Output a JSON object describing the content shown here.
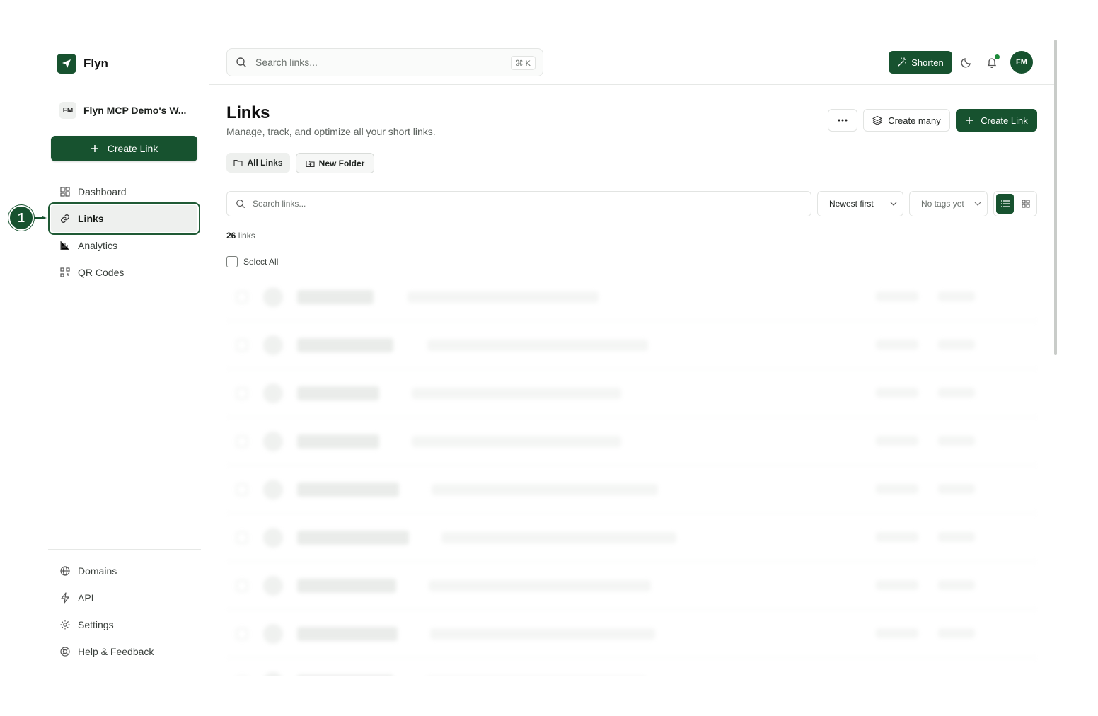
{
  "brand": {
    "name": "Flyn"
  },
  "workspace": {
    "initials": "FM",
    "name": "Flyn MCP Demo's W..."
  },
  "sidebar": {
    "create_label": "Create Link",
    "nav_top": [
      {
        "label": "Dashboard",
        "icon": "dashboard-icon"
      },
      {
        "label": "Links",
        "icon": "link-icon",
        "active": true
      },
      {
        "label": "Analytics",
        "icon": "chart-icon"
      },
      {
        "label": "QR Codes",
        "icon": "qr-icon"
      }
    ],
    "nav_bottom": [
      {
        "label": "Domains",
        "icon": "globe-icon"
      },
      {
        "label": "API",
        "icon": "lightning-icon"
      },
      {
        "label": "Settings",
        "icon": "gear-icon"
      },
      {
        "label": "Help & Feedback",
        "icon": "lifebuoy-icon"
      }
    ]
  },
  "topbar": {
    "search_placeholder": "Search links...",
    "shortcut": "⌘ K",
    "shorten_label": "Shorten",
    "user_initials": "FM"
  },
  "page": {
    "title": "Links",
    "subtitle": "Manage, track, and optimize all your short links.",
    "more_label": "•••",
    "create_many_label": "Create many",
    "create_link_label": "Create Link"
  },
  "folders": {
    "all_label": "All Links",
    "new_label": "New Folder"
  },
  "filters": {
    "search_placeholder": "Search links...",
    "sort_value": "Newest first",
    "tags_value": "No tags yet"
  },
  "list": {
    "count": "26",
    "count_suffix": "links",
    "select_all_label": "Select All"
  },
  "annotation": {
    "step": "1"
  },
  "colors": {
    "accent": "#17522f",
    "highlight_outline": "#1f5a35"
  }
}
